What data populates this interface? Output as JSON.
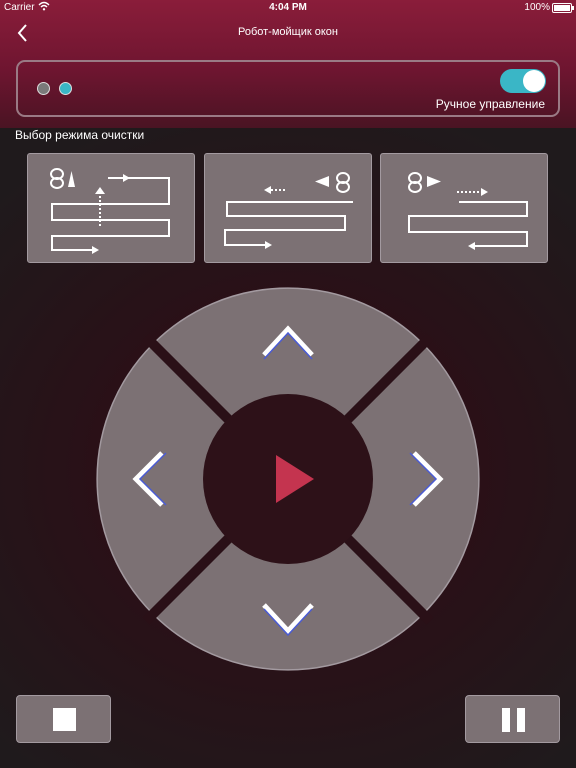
{
  "status_bar": {
    "carrier": "Carrier",
    "wifi_icon": "wifi-icon",
    "time": "4:04 PM",
    "battery_percent": "100%",
    "battery_icon": "battery-icon"
  },
  "nav": {
    "title": "Робот-мойщик окон",
    "back_icon": "chevron-left-icon"
  },
  "control_card": {
    "indicators": [
      {
        "color": "#7a7a7a"
      },
      {
        "color": "#3ab6c6"
      }
    ],
    "manual_toggle": {
      "label": "Ручное управление",
      "on": true,
      "color": "#3ab6c6"
    }
  },
  "modes": {
    "heading": "Выбор режима очистки",
    "items": [
      {
        "icon": "vertical-zigzag-mode-icon"
      },
      {
        "icon": "horizontal-zigzag-left-mode-icon"
      },
      {
        "icon": "horizontal-zigzag-right-mode-icon"
      }
    ]
  },
  "dpad": {
    "up_icon": "chevron-up-icon",
    "down_icon": "chevron-down-icon",
    "left_icon": "chevron-left-icon",
    "right_icon": "chevron-right-icon",
    "center_icon": "play-icon",
    "play_color": "#c4344f"
  },
  "bottom_controls": {
    "stop_icon": "stop-icon",
    "pause_icon": "pause-icon"
  },
  "colors": {
    "header": "#7a1834",
    "background": "#2a1017",
    "accent": "#3ab6c6",
    "button": "#7c7174"
  }
}
